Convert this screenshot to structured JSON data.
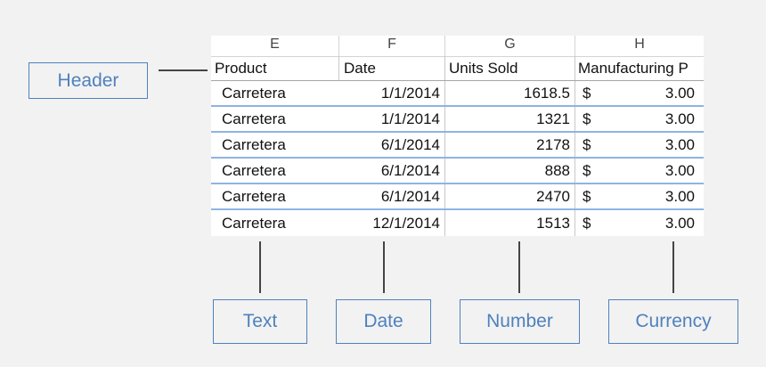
{
  "spreadsheet": {
    "column_letters": [
      "E",
      "F",
      "G",
      "H"
    ],
    "headers": [
      "Product",
      "Date",
      "Units Sold",
      "Manufacturing P"
    ],
    "rows": [
      {
        "product": "Carretera",
        "date": "1/1/2014",
        "units": "1618.5",
        "currency_symbol": "$",
        "price": "3.00"
      },
      {
        "product": "Carretera",
        "date": "1/1/2014",
        "units": "1321",
        "currency_symbol": "$",
        "price": "3.00"
      },
      {
        "product": "Carretera",
        "date": "6/1/2014",
        "units": "2178",
        "currency_symbol": "$",
        "price": "3.00"
      },
      {
        "product": "Carretera",
        "date": "6/1/2014",
        "units": "888",
        "currency_symbol": "$",
        "price": "3.00"
      },
      {
        "product": "Carretera",
        "date": "6/1/2014",
        "units": "2470",
        "currency_symbol": "$",
        "price": "3.00"
      },
      {
        "product": "Carretera",
        "date": "12/1/2014",
        "units": "1513",
        "currency_symbol": "$",
        "price": "3.00"
      }
    ]
  },
  "callouts": {
    "header": "Header",
    "text": "Text",
    "date": "Date",
    "number": "Number",
    "currency": "Currency"
  },
  "colors": {
    "accent": "#4f81bd",
    "row_border": "#8db4e2",
    "background": "#f2f2f2"
  }
}
